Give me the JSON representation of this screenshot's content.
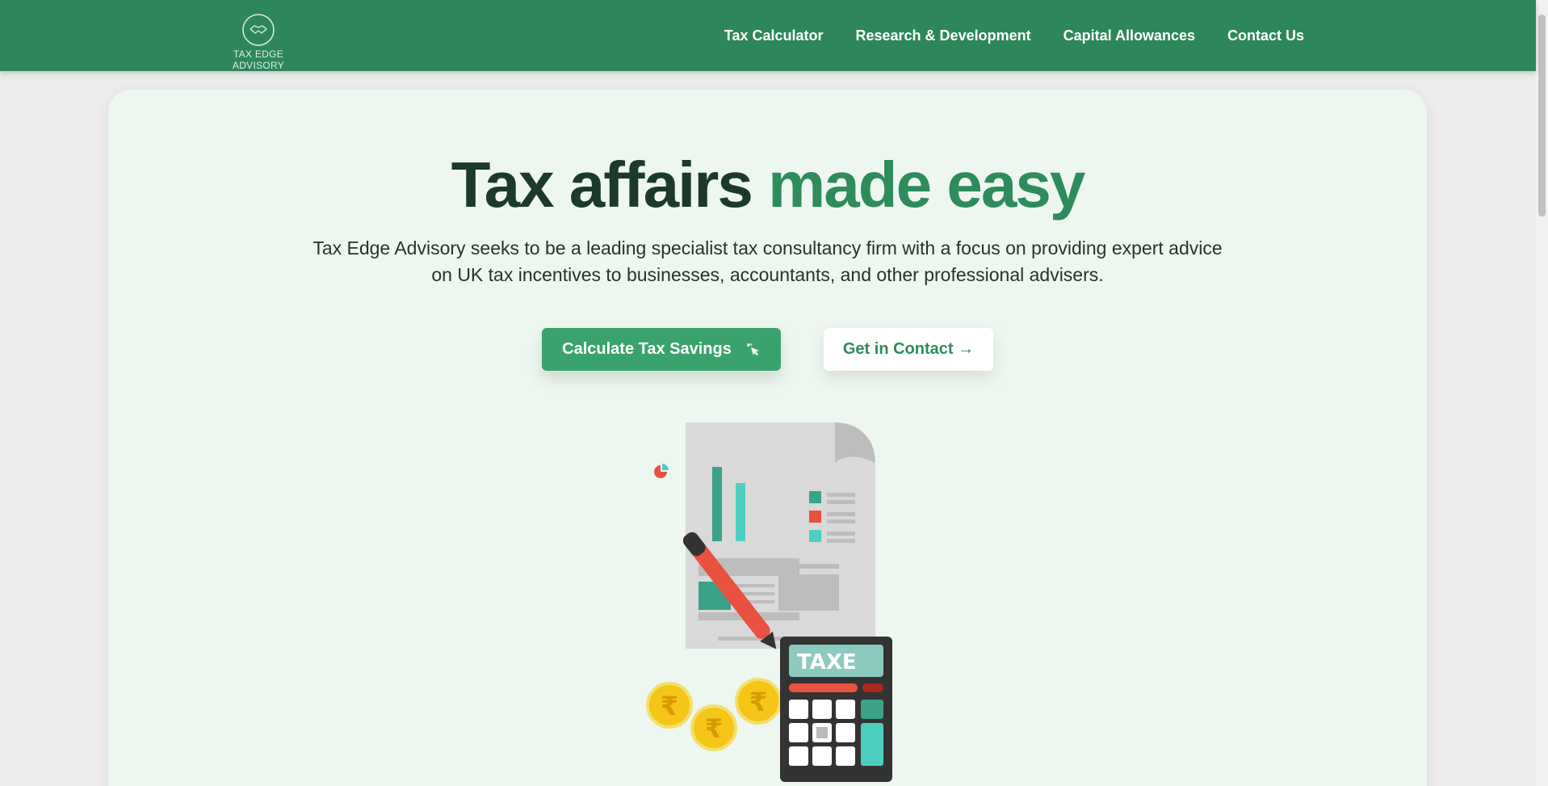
{
  "nav": {
    "logo_text": "TAX EDGE ADVISORY",
    "links": [
      "Tax Calculator",
      "Research & Development",
      "Capital Allowances",
      "Contact Us"
    ]
  },
  "hero": {
    "title_dark": "Tax affairs",
    "title_green": "made easy",
    "description": "Tax Edge Advisory seeks to be a leading specialist tax consultancy firm with a focus on providing expert advice on UK tax incentives to businesses, accountants, and other professional advisers.",
    "primary_button": "Calculate Tax Savings",
    "secondary_button": "Get in Contact →",
    "calculator_text": "TAXE"
  },
  "colors": {
    "nav": "#2e875b",
    "accent": "#3aa36d",
    "title_dark": "#1c3a2a",
    "title_green": "#2e8b5c"
  }
}
